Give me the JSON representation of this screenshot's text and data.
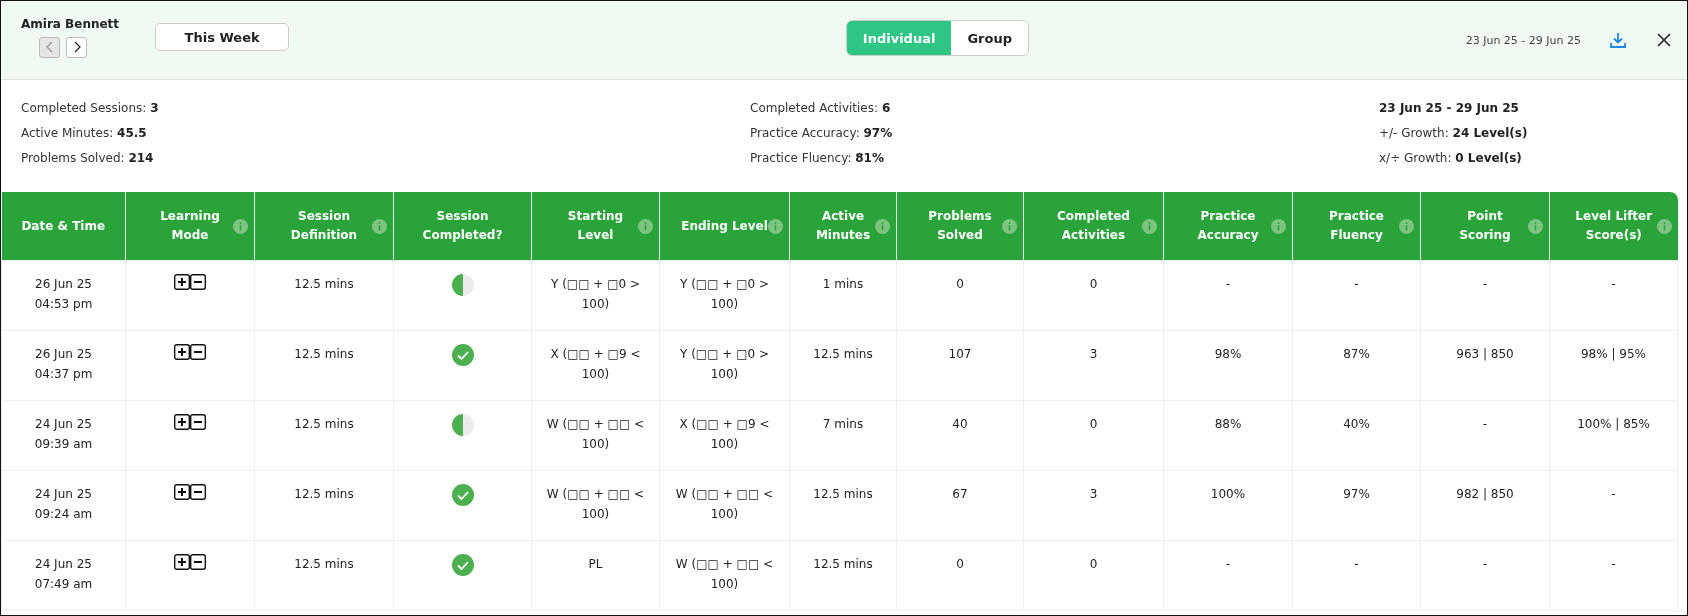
{
  "header": {
    "student": "Amira Bennett",
    "prev_disabled": true,
    "next_disabled": false,
    "period": "This Week",
    "view_tabs": [
      {
        "label": "Individual",
        "selected": true
      },
      {
        "label": "Group",
        "selected": false
      }
    ],
    "date_range": "23 Jun 25 - 29 Jun 25"
  },
  "summary": {
    "columns": [
      [
        {
          "label": "Completed Sessions:",
          "value": "3"
        },
        {
          "label": "Active Minutes:",
          "value": "45.5"
        },
        {
          "label": "Problems Solved:",
          "value": "214"
        }
      ],
      [
        {
          "label": "Completed Activities:",
          "value": "6"
        },
        {
          "label": "Practice Accuracy:",
          "value": "97%"
        },
        {
          "label": "Practice Fluency:",
          "value": "81%"
        }
      ],
      [
        {
          "value": "23 Jun 25 - 29 Jun 25"
        },
        {
          "label": "+/- Growth:",
          "value": "24 Level(s)"
        },
        {
          "label": "x/÷ Growth:",
          "value": "0 Level(s)"
        }
      ]
    ]
  },
  "table": {
    "columns": [
      {
        "label": "Date & Time",
        "info": false
      },
      {
        "label": "Learning Mode",
        "info": true
      },
      {
        "label": "Session Definition",
        "info": true
      },
      {
        "label": "Session Completed?",
        "info": false
      },
      {
        "label": "Starting Level",
        "info": true
      },
      {
        "label": "Ending Level",
        "info": true
      },
      {
        "label": "Active Minutes",
        "info": true
      },
      {
        "label": "Problems Solved",
        "info": true
      },
      {
        "label": "Completed Activities",
        "info": true
      },
      {
        "label": "Practice Accuracy",
        "info": true
      },
      {
        "label": "Practice Fluency",
        "info": true
      },
      {
        "label": "Point Scoring",
        "info": true
      },
      {
        "label": "Level Lifter Score(s)",
        "info": true
      }
    ],
    "rows": [
      {
        "date": "26 Jun 25",
        "time": "04:53 pm",
        "definition": "12.5 mins",
        "completed": false,
        "start": "Y (□□ + □0 > 100)",
        "end": "Y (□□ + □0 > 100)",
        "minutes": "1 mins",
        "problems": "0",
        "activities": "0",
        "accuracy": "-",
        "fluency": "-",
        "points": "-",
        "lifter": "-"
      },
      {
        "date": "26 Jun 25",
        "time": "04:37 pm",
        "definition": "12.5 mins",
        "completed": true,
        "start": "X (□□ + □9 < 100)",
        "end": "Y (□□ + □0 > 100)",
        "minutes": "12.5 mins",
        "problems": "107",
        "activities": "3",
        "accuracy": "98%",
        "fluency": "87%",
        "points": "963 | 850",
        "lifter": "98% | 95%"
      },
      {
        "date": "24 Jun 25",
        "time": "09:39 am",
        "definition": "12.5 mins",
        "completed": false,
        "start": "W (□□ + □□ < 100)",
        "end": "X (□□ + □9 < 100)",
        "minutes": "7 mins",
        "problems": "40",
        "activities": "0",
        "accuracy": "88%",
        "fluency": "40%",
        "points": "-",
        "lifter": "100% | 85%"
      },
      {
        "date": "24 Jun 25",
        "time": "09:24 am",
        "definition": "12.5 mins",
        "completed": true,
        "start": "W (□□ + □□ < 100)",
        "end": "W (□□ + □□ < 100)",
        "minutes": "12.5 mins",
        "problems": "67",
        "activities": "3",
        "accuracy": "100%",
        "fluency": "97%",
        "points": "982 | 850",
        "lifter": "-"
      },
      {
        "date": "24 Jun 25",
        "time": "07:49 am",
        "definition": "12.5 mins",
        "completed": true,
        "start": "PL",
        "end": "W (□□ + □□ < 100)",
        "minutes": "12.5 mins",
        "problems": "0",
        "activities": "0",
        "accuracy": "-",
        "fluency": "-",
        "points": "-",
        "lifter": "-"
      }
    ]
  }
}
